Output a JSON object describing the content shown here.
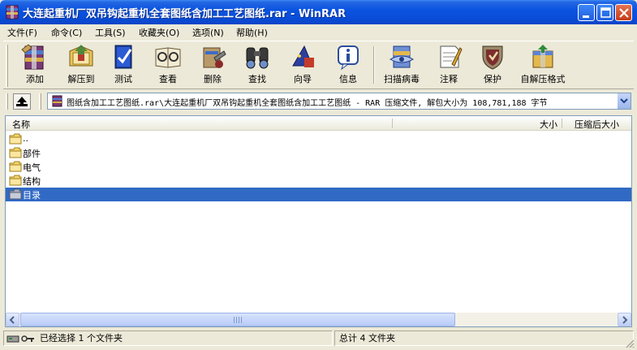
{
  "window": {
    "title": "大连起重机厂双吊钩起重机全套图纸含加工工艺图纸.rar - WinRAR",
    "controls": [
      "minimize",
      "maximize",
      "close"
    ]
  },
  "menu": {
    "items": [
      "文件(F)",
      "命令(C)",
      "工具(S)",
      "收藏夹(O)",
      "选项(N)",
      "帮助(H)"
    ]
  },
  "toolbar": {
    "buttons": [
      {
        "label": "添加",
        "icon": "add-archive-icon"
      },
      {
        "label": "解压到",
        "icon": "extract-to-icon"
      },
      {
        "label": "测试",
        "icon": "test-icon"
      },
      {
        "label": "查看",
        "icon": "view-icon"
      },
      {
        "label": "删除",
        "icon": "delete-icon"
      },
      {
        "label": "查找",
        "icon": "find-icon"
      },
      {
        "label": "向导",
        "icon": "wizard-icon"
      },
      {
        "label": "信息",
        "icon": "info-icon"
      },
      {
        "label": "扫描病毒",
        "icon": "virus-scan-icon"
      },
      {
        "label": "注释",
        "icon": "comment-icon"
      },
      {
        "label": "保护",
        "icon": "protect-icon"
      },
      {
        "label": "自解压格式",
        "icon": "sfx-icon"
      }
    ]
  },
  "address": {
    "path": "图纸含加工工艺图纸.rar\\大连起重机厂双吊钩起重机全套图纸含加工工艺图纸 - RAR 压缩文件, 解包大小为 108,781,188 字节"
  },
  "filelist": {
    "columns": {
      "name": "名称",
      "size": "大小",
      "packed": "压缩后大小"
    },
    "rows": [
      {
        "name": "..",
        "selected": false
      },
      {
        "name": "部件",
        "selected": false
      },
      {
        "name": "电气",
        "selected": false
      },
      {
        "name": "结构",
        "selected": false
      },
      {
        "name": "目录",
        "selected": true
      }
    ]
  },
  "status": {
    "left": "已经选择 1 个文件夹",
    "right": "总计 4 文件夹"
  },
  "colors": {
    "title_blue": "#0A54E0",
    "selection": "#316AC5",
    "folder_yellow": "#F5D66B"
  }
}
